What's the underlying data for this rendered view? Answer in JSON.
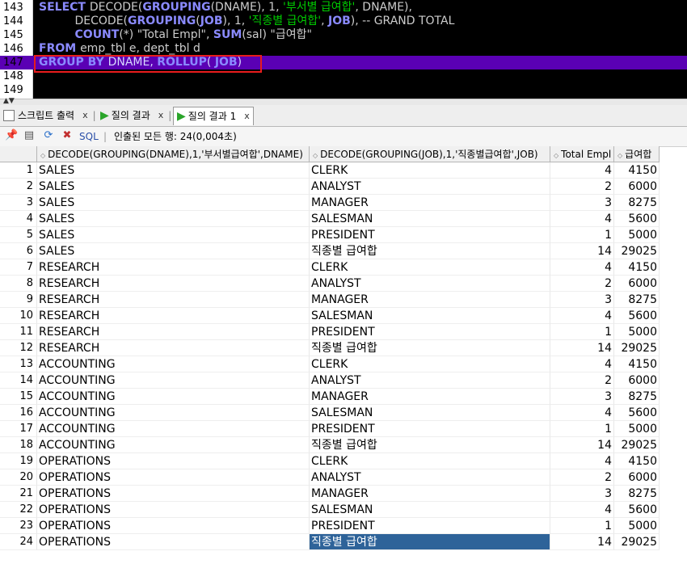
{
  "editor": {
    "lines": [
      {
        "num": "143",
        "code": [
          {
            "t": "SELECT ",
            "c": "kw"
          },
          {
            "t": "DECODE(",
            "c": ""
          },
          {
            "t": "GROUPING",
            "c": "kw"
          },
          {
            "t": "(DNAME), 1, ",
            "c": ""
          },
          {
            "t": "'부서별 급여합'",
            "c": "str"
          },
          {
            "t": ", DNAME),",
            "c": ""
          }
        ]
      },
      {
        "num": "144",
        "code": [
          {
            "t": "          DECODE(",
            "c": ""
          },
          {
            "t": "GROUPING",
            "c": "kw"
          },
          {
            "t": "(",
            "c": ""
          },
          {
            "t": "JOB",
            "c": "kw"
          },
          {
            "t": "), 1, ",
            "c": ""
          },
          {
            "t": "'직종별 급여합'",
            "c": "str"
          },
          {
            "t": ", ",
            "c": ""
          },
          {
            "t": "JOB",
            "c": "kw"
          },
          {
            "t": "), -- GRAND TOTAL",
            "c": ""
          }
        ]
      },
      {
        "num": "145",
        "code": [
          {
            "t": "          ",
            "c": ""
          },
          {
            "t": "COUNT",
            "c": "kw"
          },
          {
            "t": "(*) \"Total Empl\", ",
            "c": ""
          },
          {
            "t": "SUM",
            "c": "kw"
          },
          {
            "t": "(sal) \"급여합\"",
            "c": ""
          }
        ]
      },
      {
        "num": "146",
        "code": [
          {
            "t": "FROM ",
            "c": "kw"
          },
          {
            "t": "emp_tbl e, dept_tbl d",
            "c": ""
          }
        ]
      },
      {
        "num": "147",
        "code": [
          {
            "t": "GROUP BY ",
            "c": "kw"
          },
          {
            "t": "DNAME, ",
            "c": ""
          },
          {
            "t": "ROLLUP",
            "c": "kw"
          },
          {
            "t": "( ",
            "c": ""
          },
          {
            "t": "JOB",
            "c": "kw"
          },
          {
            "t": ")",
            "c": ""
          }
        ],
        "selected": true
      },
      {
        "num": "148",
        "code": []
      },
      {
        "num": "149",
        "code": []
      }
    ]
  },
  "tabs": [
    {
      "label": "스크립트 출력",
      "icon": "script-output-icon",
      "close": "x",
      "active": false
    },
    {
      "label": "질의 결과",
      "icon": "query-result-icon",
      "close": "x",
      "active": false
    },
    {
      "label": "질의 결과 1",
      "icon": "query-result-icon",
      "close": "x",
      "active": true
    }
  ],
  "toolbar": {
    "sql_label": "SQL",
    "status": "인출된 모든 행: 24(0,004초)"
  },
  "grid": {
    "columns": [
      "DECODE(GROUPING(DNAME),1,'부서별급여합',DNAME)",
      "DECODE(GROUPING(JOB),1,'직종별급여합',JOB)",
      "Total Empl",
      "급여합"
    ],
    "rows": [
      [
        "1",
        "SALES",
        "CLERK",
        "4",
        "4150"
      ],
      [
        "2",
        "SALES",
        "ANALYST",
        "2",
        "6000"
      ],
      [
        "3",
        "SALES",
        "MANAGER",
        "3",
        "8275"
      ],
      [
        "4",
        "SALES",
        "SALESMAN",
        "4",
        "5600"
      ],
      [
        "5",
        "SALES",
        "PRESIDENT",
        "1",
        "5000"
      ],
      [
        "6",
        "SALES",
        "직종별 급여합",
        "14",
        "29025"
      ],
      [
        "7",
        "RESEARCH",
        "CLERK",
        "4",
        "4150"
      ],
      [
        "8",
        "RESEARCH",
        "ANALYST",
        "2",
        "6000"
      ],
      [
        "9",
        "RESEARCH",
        "MANAGER",
        "3",
        "8275"
      ],
      [
        "10",
        "RESEARCH",
        "SALESMAN",
        "4",
        "5600"
      ],
      [
        "11",
        "RESEARCH",
        "PRESIDENT",
        "1",
        "5000"
      ],
      [
        "12",
        "RESEARCH",
        "직종별 급여합",
        "14",
        "29025"
      ],
      [
        "13",
        "ACCOUNTING",
        "CLERK",
        "4",
        "4150"
      ],
      [
        "14",
        "ACCOUNTING",
        "ANALYST",
        "2",
        "6000"
      ],
      [
        "15",
        "ACCOUNTING",
        "MANAGER",
        "3",
        "8275"
      ],
      [
        "16",
        "ACCOUNTING",
        "SALESMAN",
        "4",
        "5600"
      ],
      [
        "17",
        "ACCOUNTING",
        "PRESIDENT",
        "1",
        "5000"
      ],
      [
        "18",
        "ACCOUNTING",
        "직종별 급여합",
        "14",
        "29025"
      ],
      [
        "19",
        "OPERATIONS",
        "CLERK",
        "4",
        "4150"
      ],
      [
        "20",
        "OPERATIONS",
        "ANALYST",
        "2",
        "6000"
      ],
      [
        "21",
        "OPERATIONS",
        "MANAGER",
        "3",
        "8275"
      ],
      [
        "22",
        "OPERATIONS",
        "SALESMAN",
        "4",
        "5600"
      ],
      [
        "23",
        "OPERATIONS",
        "PRESIDENT",
        "1",
        "5000"
      ],
      [
        "24",
        "OPERATIONS",
        "직종별 급여합",
        "14",
        "29025"
      ]
    ],
    "selected_cell": {
      "row": 23,
      "col": 2
    }
  }
}
